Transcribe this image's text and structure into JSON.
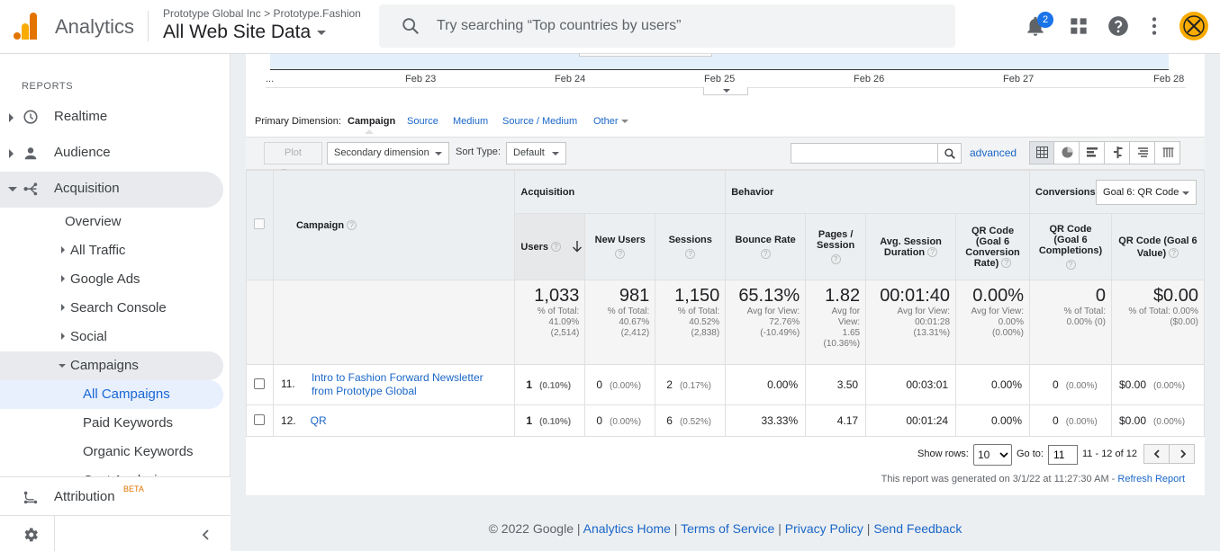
{
  "app": {
    "brand": "Analytics",
    "breadcrumb": {
      "account": "Prototype Global Inc",
      "separator": ">",
      "property": "Prototype.Fashion"
    },
    "view": "All Web Site Data",
    "search_placeholder": "Try searching “Top countries by users”",
    "notification_count": "2",
    "brand_colors": {
      "bar1": "#f9ab00",
      "bar2": "#e37400",
      "accent": "#1a73e8"
    }
  },
  "sidebar": {
    "section_label": "REPORTS",
    "items": [
      {
        "label": "Realtime",
        "icon": "clock-icon"
      },
      {
        "label": "Audience",
        "icon": "person-icon"
      },
      {
        "label": "Acquisition",
        "icon": "acquisition-icon"
      }
    ],
    "acquisition_sub": {
      "overview": "Overview",
      "all_traffic": "All Traffic",
      "google_ads": "Google Ads",
      "search_console": "Search Console",
      "social": "Social",
      "campaigns": "Campaigns",
      "all_campaigns": "All Campaigns",
      "paid_keywords": "Paid Keywords",
      "organic_keywords": "Organic Keywords",
      "cost_analysis": "Cost Analysis"
    },
    "attribution": {
      "label": "Attribution",
      "badge": "BETA"
    }
  },
  "chart": {
    "x_ticks": [
      "...",
      "Feb 23",
      "Feb 24",
      "Feb 25",
      "Feb 26",
      "Feb 27",
      "Feb 28"
    ]
  },
  "dimensions": {
    "label": "Primary Dimension:",
    "active": "Campaign",
    "options": [
      "Source",
      "Medium",
      "Source / Medium"
    ],
    "other": "Other"
  },
  "toolbar": {
    "plot_rows": "Plot Rows",
    "secondary_dimension": "Secondary dimension",
    "sort_type_label": "Sort Type:",
    "sort_type_value": "Default",
    "advanced": "advanced"
  },
  "table": {
    "headers": {
      "campaign": "Campaign",
      "acquisition": "Acquisition",
      "behavior": "Behavior",
      "conversions": "Conversions",
      "goal_select": "Goal 6: QR Code",
      "users": "Users",
      "new_users": "New Users",
      "sessions": "Sessions",
      "bounce_rate": "Bounce Rate",
      "pages_session": "Pages / Session",
      "avg_session": "Avg. Session Duration",
      "qr_conv_rate": "QR Code (Goal 6 Conversion Rate)",
      "qr_completions": "QR Code (Goal 6 Completions)",
      "qr_value": "QR Code (Goal 6 Value)"
    },
    "totals": {
      "users": {
        "value": "1,033",
        "sub1": "% of Total:",
        "sub2": "41.09%",
        "sub3": "(2,514)"
      },
      "new_users": {
        "value": "981",
        "sub1": "% of Total:",
        "sub2": "40.67%",
        "sub3": "(2,412)"
      },
      "sessions": {
        "value": "1,150",
        "sub1": "% of Total:",
        "sub2": "40.52%",
        "sub3": "(2,838)"
      },
      "bounce_rate": {
        "value": "65.13%",
        "sub1": "Avg for View:",
        "sub2": "72.76%",
        "sub3": "(-10.49%)"
      },
      "pages_session": {
        "value": "1.82",
        "sub1": "Avg for",
        "sub2": "View:",
        "sub3": "1.65",
        "sub4": "(10.36%)"
      },
      "avg_session": {
        "value": "00:01:40",
        "sub1": "Avg for View:",
        "sub2": "00:01:28",
        "sub3": "(13.31%)"
      },
      "qr_conv_rate": {
        "value": "0.00%",
        "sub1": "Avg for View:",
        "sub2": "0.00%",
        "sub3": "(0.00%)"
      },
      "qr_completions": {
        "value": "0",
        "sub1": "% of Total:",
        "sub2": "0.00% (0)"
      },
      "qr_value": {
        "value": "$0.00",
        "sub1": "% of Total: 0.00%",
        "sub2": "($0.00)"
      }
    },
    "rows": [
      {
        "num": "11.",
        "campaign_l1": "Intro to Fashion Forward Newsletter",
        "campaign_l2": "from Prototype Global",
        "users": "1",
        "users_pct": "(0.10%)",
        "new_users": "0",
        "new_users_pct": "(0.00%)",
        "sessions": "2",
        "sessions_pct": "(0.17%)",
        "bounce": "0.00%",
        "pages": "3.50",
        "duration": "00:03:01",
        "conv": "0.00%",
        "comp": "0",
        "comp_pct": "(0.00%)",
        "value": "$0.00",
        "value_pct": "(0.00%)"
      },
      {
        "num": "12.",
        "campaign_l1": "QR",
        "campaign_l2": "",
        "users": "1",
        "users_pct": "(0.10%)",
        "new_users": "0",
        "new_users_pct": "(0.00%)",
        "sessions": "6",
        "sessions_pct": "(0.52%)",
        "bounce": "33.33%",
        "pages": "4.17",
        "duration": "00:01:24",
        "conv": "0.00%",
        "comp": "0",
        "comp_pct": "(0.00%)",
        "value": "$0.00",
        "value_pct": "(0.00%)"
      }
    ]
  },
  "pagination": {
    "show_rows_label": "Show rows:",
    "show_rows_value": "10",
    "goto_label": "Go to:",
    "goto_value": "11",
    "range": "11 - 12 of 12"
  },
  "report_info": {
    "generated": "This report was generated on 3/1/22 at 11:27:30 AM -",
    "refresh": "Refresh Report"
  },
  "footer": {
    "copyright": "© 2022 Google",
    "links": [
      "Analytics Home",
      "Terms of Service",
      "Privacy Policy",
      "Send Feedback"
    ]
  }
}
